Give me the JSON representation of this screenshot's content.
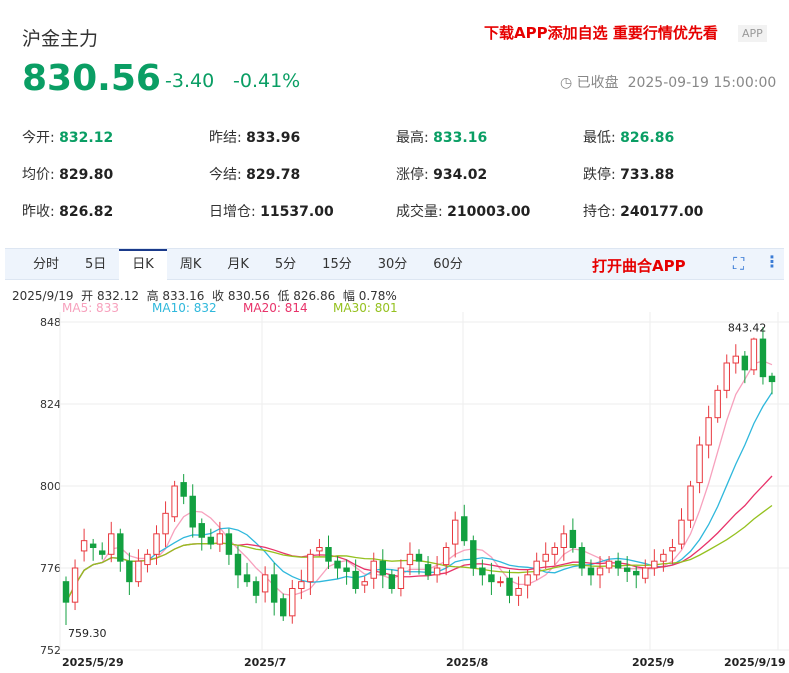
{
  "header": {
    "title": "沪金主力",
    "promo": "下载APP添加自选 重要行情优先看",
    "app_badge": "APP",
    "price": "830.56",
    "change": "-3.40",
    "change_pct": "-0.41%",
    "status": "已收盘",
    "datetime": "2025-09-19 15:00:00"
  },
  "stats": [
    [
      {
        "label": "今开:",
        "value": "832.12",
        "green": true
      },
      {
        "label": "昨结:",
        "value": "833.96"
      },
      {
        "label": "最高:",
        "value": "833.16",
        "green": true
      },
      {
        "label": "最低:",
        "value": "826.86",
        "green": true
      }
    ],
    [
      {
        "label": "均价:",
        "value": "829.80"
      },
      {
        "label": "今结:",
        "value": "829.78"
      },
      {
        "label": "涨停:",
        "value": "934.02"
      },
      {
        "label": "跌停:",
        "value": "733.88"
      }
    ],
    [
      {
        "label": "昨收:",
        "value": "826.82"
      },
      {
        "label": "日增仓:",
        "value": "11537.00"
      },
      {
        "label": "成交量:",
        "value": "210003.00"
      },
      {
        "label": "持仓:",
        "value": "240177.00"
      }
    ]
  ],
  "tabs": [
    "分时",
    "5日",
    "日K",
    "周K",
    "月K",
    "5分",
    "15分",
    "30分",
    "60分"
  ],
  "active_tab": "日K",
  "open_app": "打开曲合APP",
  "info_line": "2025/9/19  开 832.12  高 833.16  收 830.56  低 826.86  幅 0.78%",
  "ma": [
    {
      "label": "MA5: 833",
      "color": "#f7a1bd"
    },
    {
      "label": "MA10: 832",
      "color": "#2fb8dc"
    },
    {
      "label": "MA20: 814",
      "color": "#e8336a"
    },
    {
      "label": "MA30: 801",
      "color": "#95c11f"
    }
  ],
  "chart_data": {
    "type": "candlestick",
    "ylim": [
      752,
      848
    ],
    "yticks": [
      "848",
      "824",
      "800",
      "776",
      "752"
    ],
    "xticks": [
      "2025/5/29",
      "2025/7",
      "2025/8",
      "2025/9",
      "2025/9/19"
    ],
    "max_label": "843.42",
    "min_label": "759.30",
    "up_color": "#e8393f",
    "down_color": "#13a040",
    "open": [
      772,
      766,
      781,
      783,
      781,
      780,
      786,
      778,
      772,
      777,
      780,
      786,
      791,
      801,
      797,
      789,
      785,
      783,
      786,
      780,
      774,
      772,
      769,
      774,
      767,
      762,
      770,
      772,
      781,
      782,
      778,
      776,
      775,
      771,
      773,
      778,
      774,
      770,
      777,
      780,
      777,
      774,
      777,
      783,
      791,
      784,
      776,
      774,
      772,
      773,
      768,
      771,
      774,
      778,
      780,
      782,
      787,
      782,
      776,
      774,
      776,
      778,
      776,
      775,
      773,
      776,
      778,
      781,
      783,
      790,
      801,
      812,
      820,
      828,
      836,
      838,
      834,
      843,
      832.12
    ],
    "close": [
      766,
      776,
      784,
      782,
      780,
      786,
      778,
      772,
      778,
      780,
      786,
      792,
      800,
      797,
      788,
      785,
      783,
      786,
      780,
      774,
      772,
      768,
      774,
      766,
      762,
      770,
      772,
      780,
      782,
      778,
      776,
      775,
      770,
      772,
      778,
      774,
      770,
      776,
      780,
      778,
      774,
      776,
      782,
      790,
      784,
      776,
      774,
      772,
      772,
      768,
      770,
      774,
      778,
      780,
      782,
      786,
      782,
      776,
      774,
      776,
      778,
      776,
      775,
      774,
      776,
      778,
      780,
      782,
      790,
      800,
      812,
      820,
      828,
      836,
      838,
      834,
      843,
      832,
      830.56
    ]
  }
}
